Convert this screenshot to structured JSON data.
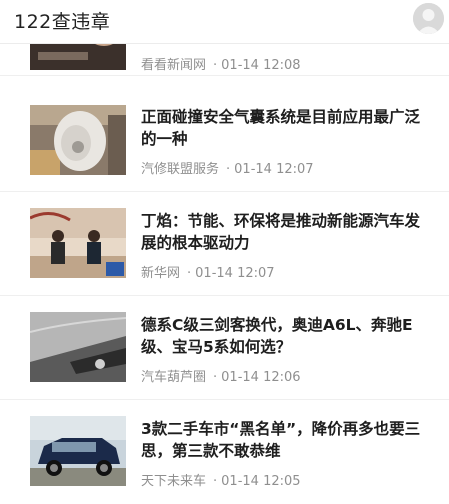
{
  "header": {
    "title": "122查违章"
  },
  "articles": [
    {
      "source": "看看新闻网",
      "time": "01-14 12:08"
    },
    {
      "title": "正面碰撞安全气囊系统是目前应用最广泛的一种",
      "source": "汽修联盟服务",
      "time": "01-14 12:07"
    },
    {
      "title": "丁焰：节能、环保将是推动新能源汽车发展的根本驱动力",
      "source": "新华网",
      "time": "01-14 12:07"
    },
    {
      "title": "德系C级三剑客换代，奥迪A6L、奔驰E级、宝马5系如何选？",
      "source": "汽车葫芦圈",
      "time": "01-14 12:06"
    },
    {
      "title": "3款二手车市“黑名单”，降价再多也要三思，第三款不敢恭维",
      "source": "天下未来车",
      "time": "01-14 12:05"
    }
  ]
}
